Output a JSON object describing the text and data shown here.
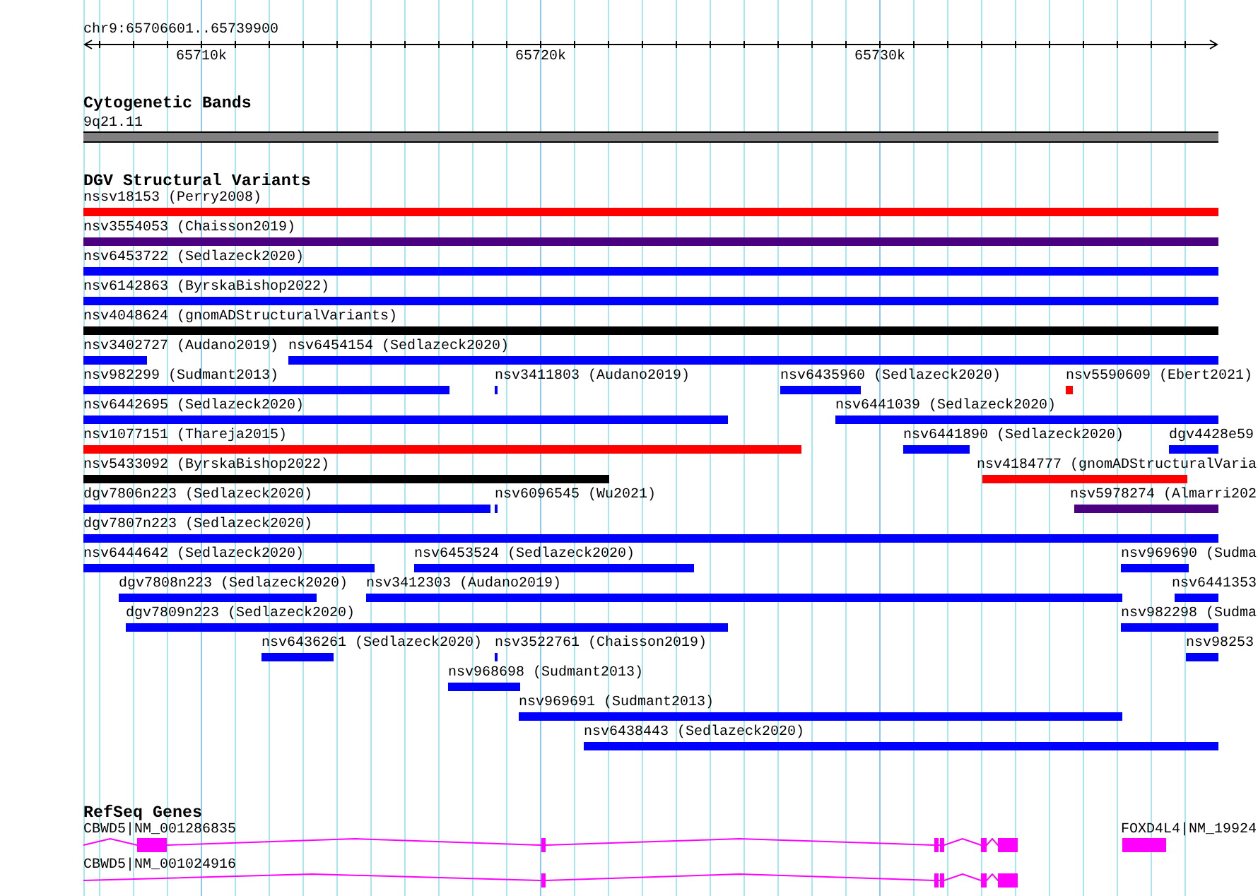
{
  "ruler": {
    "location": "chr9:65706601..65739900",
    "ticks": [
      "65710k",
      "65720k",
      "65730k"
    ]
  },
  "tracks": [
    {
      "kind": "cytoband",
      "title": "Cytogenetic Bands",
      "features": [
        {
          "label": "9q21.11"
        }
      ]
    },
    {
      "kind": "variants",
      "title": "DGV Structural Variants",
      "features": [
        {
          "label": "nssv18153 (Perry2008)",
          "color": "#ff0000"
        },
        {
          "label": "nsv3554053 (Chaisson2019)",
          "color": "#4b0082"
        },
        {
          "label": "nsv6453722 (Sedlazeck2020)",
          "color": "#0000ff"
        },
        {
          "label": "nsv6142863 (ByrskaBishop2022)",
          "color": "#0000ff"
        },
        {
          "label": "nsv4048624 (gnomADStructuralVariants)",
          "color": "#000000"
        },
        {
          "label": "nsv3402727 (Audano2019)",
          "color": "#0000ff"
        },
        {
          "label": "nsv6454154 (Sedlazeck2020)",
          "color": "#0000ff"
        },
        {
          "label": "nsv982299 (Sudmant2013)",
          "color": "#0000ff"
        },
        {
          "label": "nsv3411803 (Audano2019)",
          "color": "#0000ff"
        },
        {
          "label": "nsv6435960 (Sedlazeck2020)",
          "color": "#0000ff"
        },
        {
          "label": "nsv5590609 (Ebert2021)",
          "color": "#ff0000"
        },
        {
          "label": "nsv6442695 (Sedlazeck2020)",
          "color": "#0000ff"
        },
        {
          "label": "nsv6441039 (Sedlazeck2020)",
          "color": "#0000ff"
        },
        {
          "label": "nsv1077151 (Thareja2015)",
          "color": "#ff0000"
        },
        {
          "label": "nsv6441890 (Sedlazeck2020)",
          "color": "#0000ff"
        },
        {
          "label": "dgv4428e59",
          "color": "#0000ff"
        },
        {
          "label": "nsv5433092 (ByrskaBishop2022)",
          "color": "#000000"
        },
        {
          "label": "nsv4184777 (gnomADStructuralVaria",
          "color": "#ff0000"
        },
        {
          "label": "dgv7806n223 (Sedlazeck2020)",
          "color": "#0000ff"
        },
        {
          "label": "nsv6096545 (Wu2021)",
          "color": "#0000ff"
        },
        {
          "label": "nsv5978274 (Almarri202",
          "color": "#4b0082"
        },
        {
          "label": "dgv7807n223 (Sedlazeck2020)",
          "color": "#0000ff"
        },
        {
          "label": "nsv6444642 (Sedlazeck2020)",
          "color": "#0000ff"
        },
        {
          "label": "nsv6453524 (Sedlazeck2020)",
          "color": "#0000ff"
        },
        {
          "label": "nsv969690 (Sudma",
          "color": "#0000ff"
        },
        {
          "label": "dgv7808n223 (Sedlazeck2020)",
          "color": "#0000ff"
        },
        {
          "label": "nsv3412303 (Audano2019)",
          "color": "#0000ff"
        },
        {
          "label": "nsv6441353",
          "color": "#0000ff"
        },
        {
          "label": "dgv7809n223 (Sedlazeck2020)",
          "color": "#0000ff"
        },
        {
          "label": "nsv982298 (Sudma",
          "color": "#0000ff"
        },
        {
          "label": "nsv6436261 (Sedlazeck2020)",
          "color": "#0000ff"
        },
        {
          "label": "nsv3522761 (Chaisson2019)",
          "color": "#0000ff"
        },
        {
          "label": "nsv98253",
          "color": "#0000ff"
        },
        {
          "label": "nsv968698 (Sudmant2013)",
          "color": "#0000ff"
        },
        {
          "label": "nsv969691 (Sudmant2013)",
          "color": "#0000ff"
        },
        {
          "label": "nsv6438443 (Sedlazeck2020)",
          "color": "#0000ff"
        }
      ]
    },
    {
      "kind": "genes",
      "title": "RefSeq Genes",
      "features": [
        {
          "label": "CBWD5|NM_001286835"
        },
        {
          "label": "FOXD4L4|NM_19924"
        },
        {
          "label": "CBWD5|NM_001024916"
        }
      ]
    }
  ]
}
